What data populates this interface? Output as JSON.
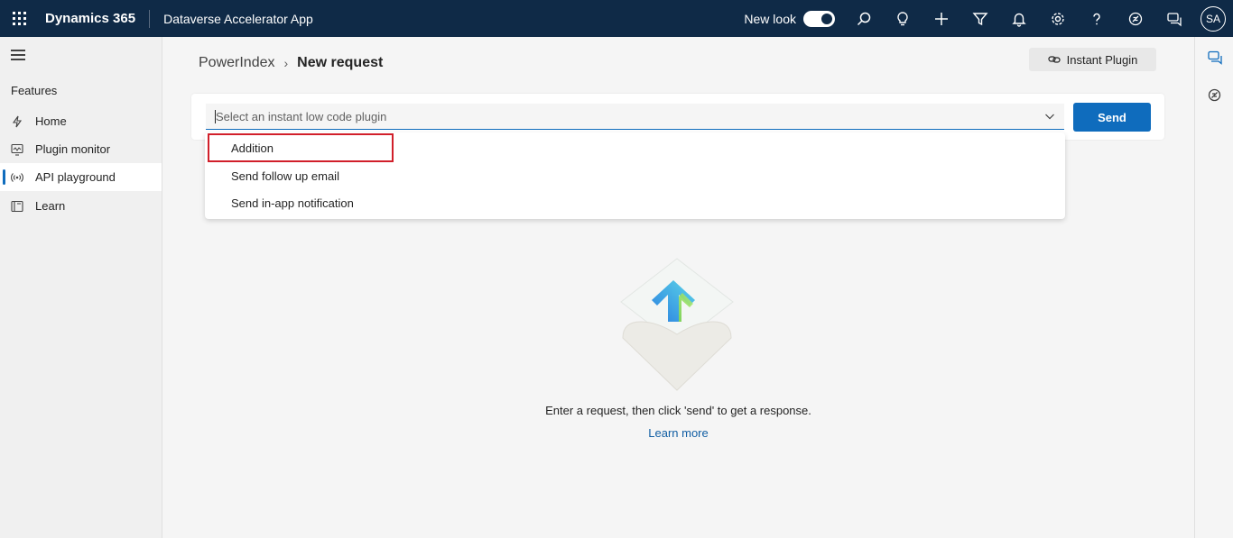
{
  "topbar": {
    "brand": "Dynamics 365",
    "app_name": "Dataverse Accelerator App",
    "new_look_label": "New look",
    "avatar_initials": "SA"
  },
  "leftnav": {
    "section_title": "Features",
    "items": [
      {
        "label": "Home",
        "icon": "lightning-icon"
      },
      {
        "label": "Plugin monitor",
        "icon": "monitor-icon"
      },
      {
        "label": "API playground",
        "icon": "broadcast-icon",
        "active": true
      },
      {
        "label": "Learn",
        "icon": "book-icon"
      }
    ]
  },
  "breadcrumb": {
    "root": "PowerIndex",
    "current": "New request"
  },
  "toolbar": {
    "instant_plugin_label": "Instant Plugin"
  },
  "request": {
    "select_placeholder": "Select an instant low code plugin",
    "send_label": "Send"
  },
  "dropdown": {
    "options": [
      "Addition",
      "Send follow up email",
      "Send in-app notification"
    ],
    "highlighted": "Addition"
  },
  "empty_state": {
    "message": "Enter a request, then click 'send' to get a response.",
    "link": "Learn more"
  },
  "colors": {
    "topbar": "#0f2a47",
    "accent": "#0f6cbd",
    "highlight_border": "#d11f2a",
    "link": "#115ea3"
  }
}
